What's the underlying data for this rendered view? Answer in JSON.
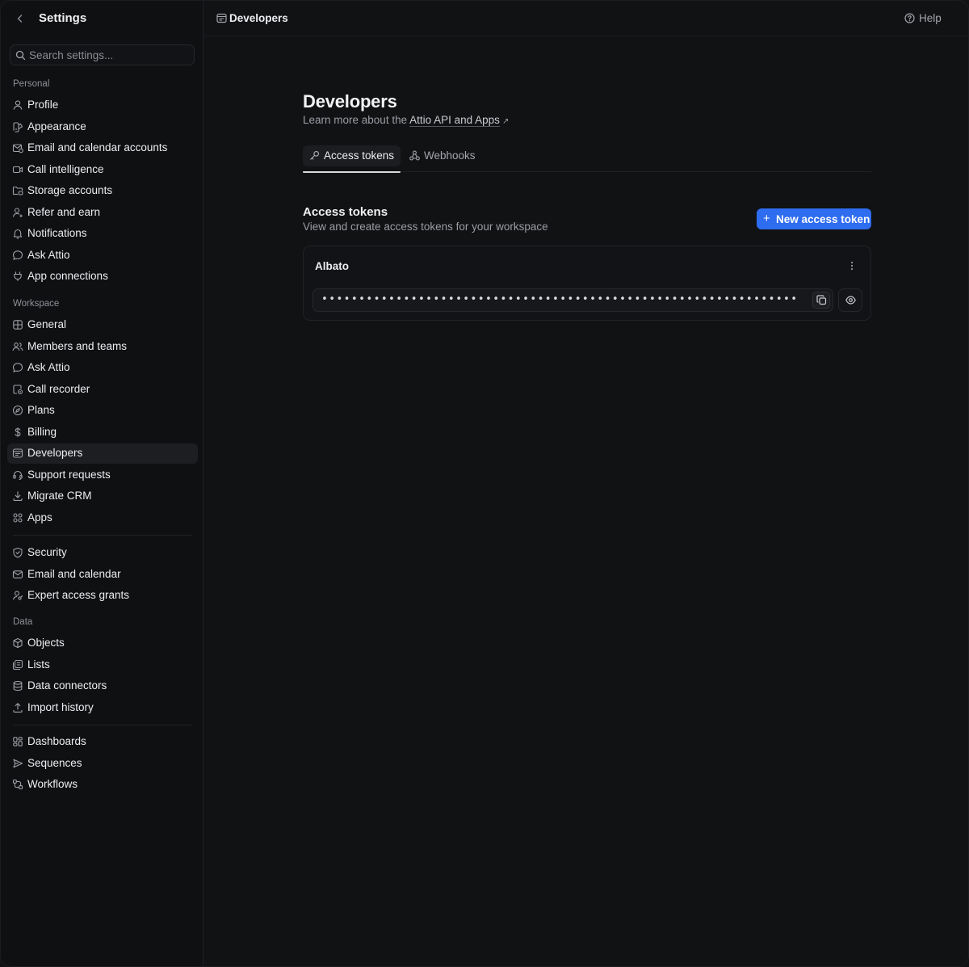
{
  "sidebar": {
    "title": "Settings",
    "search_placeholder": "Search settings...",
    "sections": {
      "personal": "Personal",
      "workspace": "Workspace",
      "data": "Data"
    },
    "personal_items": [
      {
        "label": "Profile",
        "icon": "user-icon"
      },
      {
        "label": "Appearance",
        "icon": "palette-icon"
      },
      {
        "label": "Email and calendar accounts",
        "icon": "mail-calendar-icon"
      },
      {
        "label": "Call intelligence",
        "icon": "video-icon"
      },
      {
        "label": "Storage accounts",
        "icon": "folder-cloud-icon"
      },
      {
        "label": "Refer and earn",
        "icon": "user-plus-icon"
      },
      {
        "label": "Notifications",
        "icon": "bell-icon"
      },
      {
        "label": "Ask Attio",
        "icon": "chat-bubble-icon"
      },
      {
        "label": "App connections",
        "icon": "plug-icon"
      }
    ],
    "workspace_items": [
      {
        "label": "General",
        "icon": "grid-icon"
      },
      {
        "label": "Members and teams",
        "icon": "users-icon"
      },
      {
        "label": "Ask Attio",
        "icon": "chat-bubble-icon"
      },
      {
        "label": "Call recorder",
        "icon": "call-recorder-icon"
      },
      {
        "label": "Plans",
        "icon": "compass-icon"
      },
      {
        "label": "Billing",
        "icon": "dollar-icon"
      },
      {
        "label": "Developers",
        "icon": "code-window-icon"
      },
      {
        "label": "Support requests",
        "icon": "headset-icon"
      },
      {
        "label": "Migrate CRM",
        "icon": "download-icon"
      },
      {
        "label": "Apps",
        "icon": "apps-icon"
      }
    ],
    "workspace_items_2": [
      {
        "label": "Security",
        "icon": "shield-icon"
      },
      {
        "label": "Email and calendar",
        "icon": "envelope-icon"
      },
      {
        "label": "Expert access grants",
        "icon": "user-key-icon"
      }
    ],
    "data_items": [
      {
        "label": "Objects",
        "icon": "cube-icon"
      },
      {
        "label": "Lists",
        "icon": "list-icon"
      },
      {
        "label": "Data connectors",
        "icon": "database-icon"
      },
      {
        "label": "Import history",
        "icon": "upload-icon"
      }
    ],
    "data_items_2": [
      {
        "label": "Dashboards",
        "icon": "dashboard-icon"
      },
      {
        "label": "Sequences",
        "icon": "send-icon"
      },
      {
        "label": "Workflows",
        "icon": "workflow-icon"
      }
    ],
    "active": "Developers"
  },
  "topbar": {
    "breadcrumb": "Developers",
    "help_label": "Help"
  },
  "main": {
    "title": "Developers",
    "subtitle_prefix": "Learn more about the ",
    "subtitle_link": "Attio API and Apps",
    "tabs": [
      {
        "label": "Access tokens",
        "icon": "key-icon",
        "active": true
      },
      {
        "label": "Webhooks",
        "icon": "webhook-icon",
        "active": false
      }
    ],
    "section_title": "Access tokens",
    "section_subtitle": "View and create access tokens for your workspace",
    "new_button_label": "New access token",
    "tokens": [
      {
        "name": "Albato",
        "masked_value": "••••••••••••••••••••••••••••••••••••••••••••••••••••••••••••••••"
      }
    ]
  },
  "colors": {
    "accent": "#2e6cf0",
    "background": "#111214",
    "sidebar_bg": "#0f1012"
  }
}
